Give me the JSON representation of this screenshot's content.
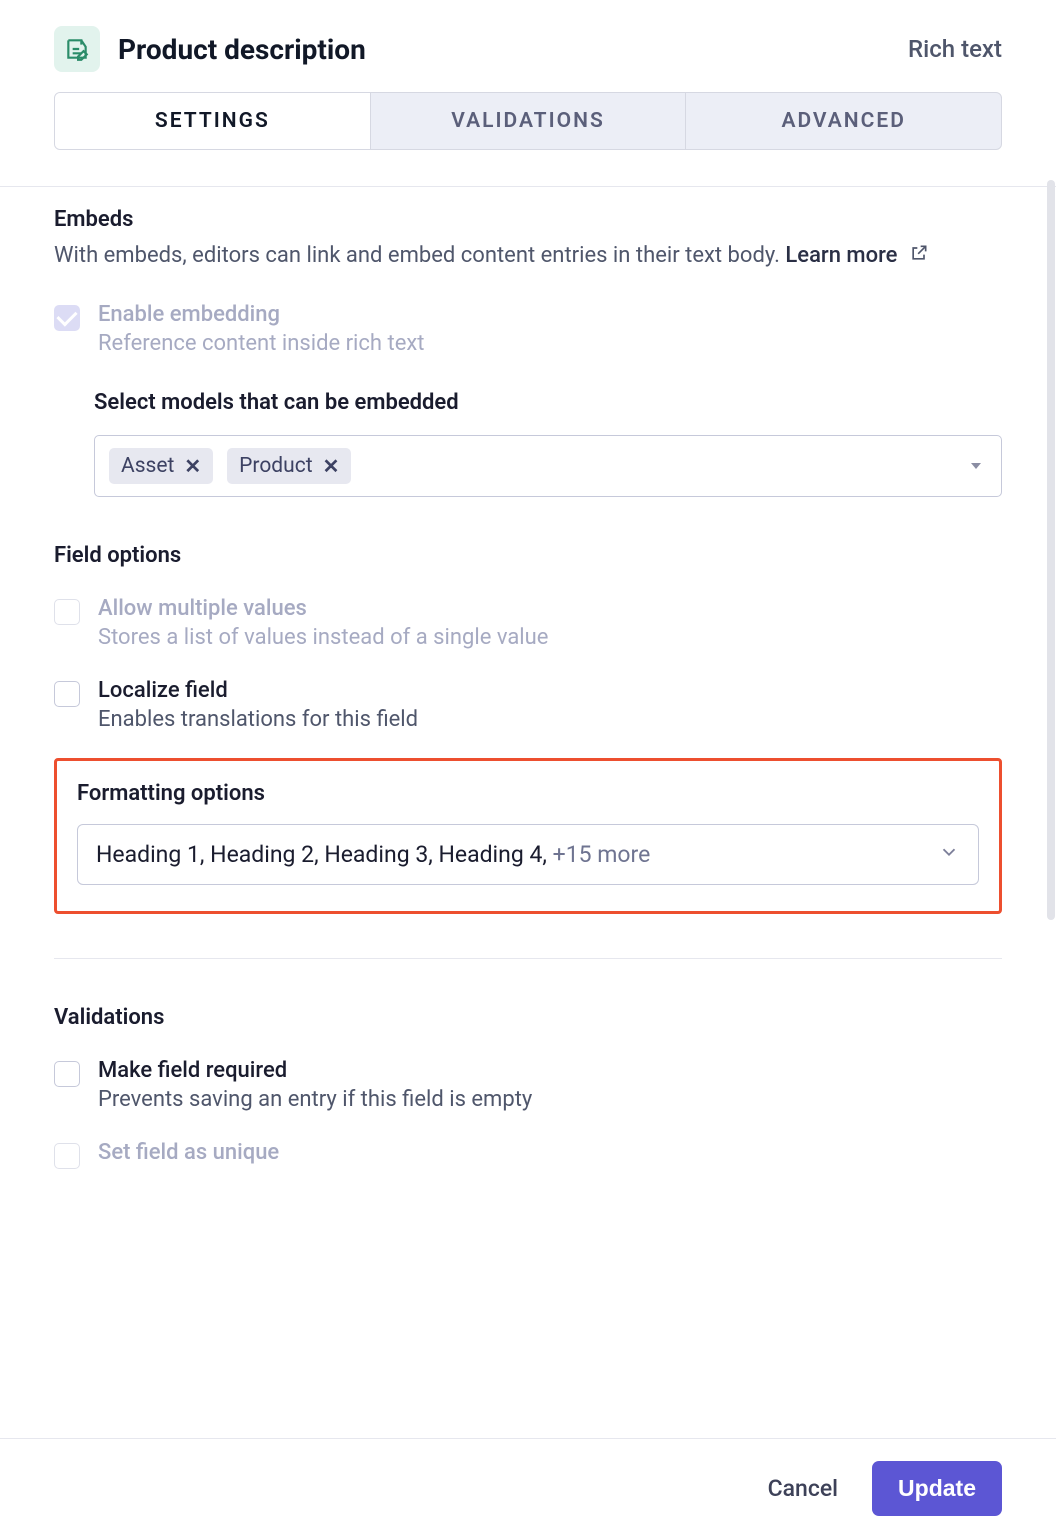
{
  "header": {
    "title": "Product description",
    "type_label": "Rich text"
  },
  "tabs": {
    "settings": "SETTINGS",
    "validations": "VALIDATIONS",
    "advanced": "ADVANCED"
  },
  "embeds": {
    "title": "Embeds",
    "desc": "With embeds, editors can link and embed content entries in their text body.",
    "learn_more": "Learn more",
    "enable_label": "Enable embedding",
    "enable_sub": "Reference content inside rich text",
    "select_models_title": "Select models that can be embedded",
    "chips": [
      "Asset",
      "Product"
    ]
  },
  "field_options": {
    "title": "Field options",
    "multi_label": "Allow multiple values",
    "multi_sub": "Stores a list of values instead of a single value",
    "localize_label": "Localize field",
    "localize_sub": "Enables translations for this field"
  },
  "formatting": {
    "title": "Formatting options",
    "summary_main": "Heading 1, Heading 2, Heading 3, Heading 4, ",
    "summary_more": "+15 more"
  },
  "validations": {
    "title": "Validations",
    "required_label": "Make field required",
    "required_sub": "Prevents saving an entry if this field is empty",
    "unique_label": "Set field as unique"
  },
  "footer": {
    "cancel": "Cancel",
    "update": "Update"
  }
}
